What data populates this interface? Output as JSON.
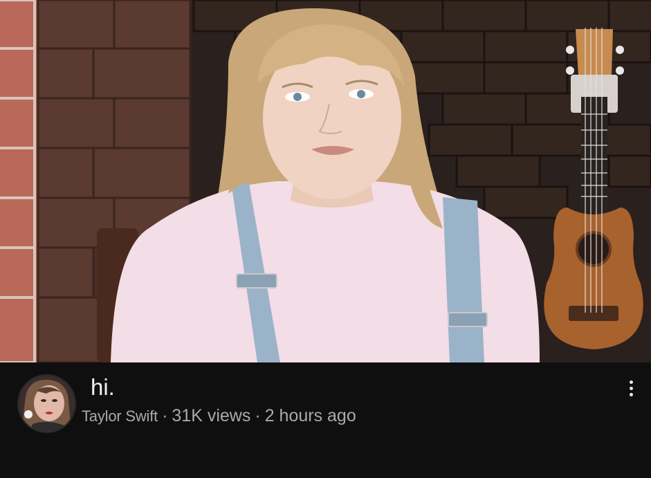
{
  "video": {
    "title": "hi.",
    "channel": "Taylor Swift",
    "views": "31K views",
    "age": "2 hours ago",
    "separator": "·"
  },
  "icons": {
    "more": "more-vert-icon",
    "avatar": "channel-avatar",
    "thumbnail": "video-thumbnail"
  },
  "colors": {
    "background": "#0f0f0f",
    "title": "#f1f1f1",
    "meta": "#aaaaaa"
  }
}
